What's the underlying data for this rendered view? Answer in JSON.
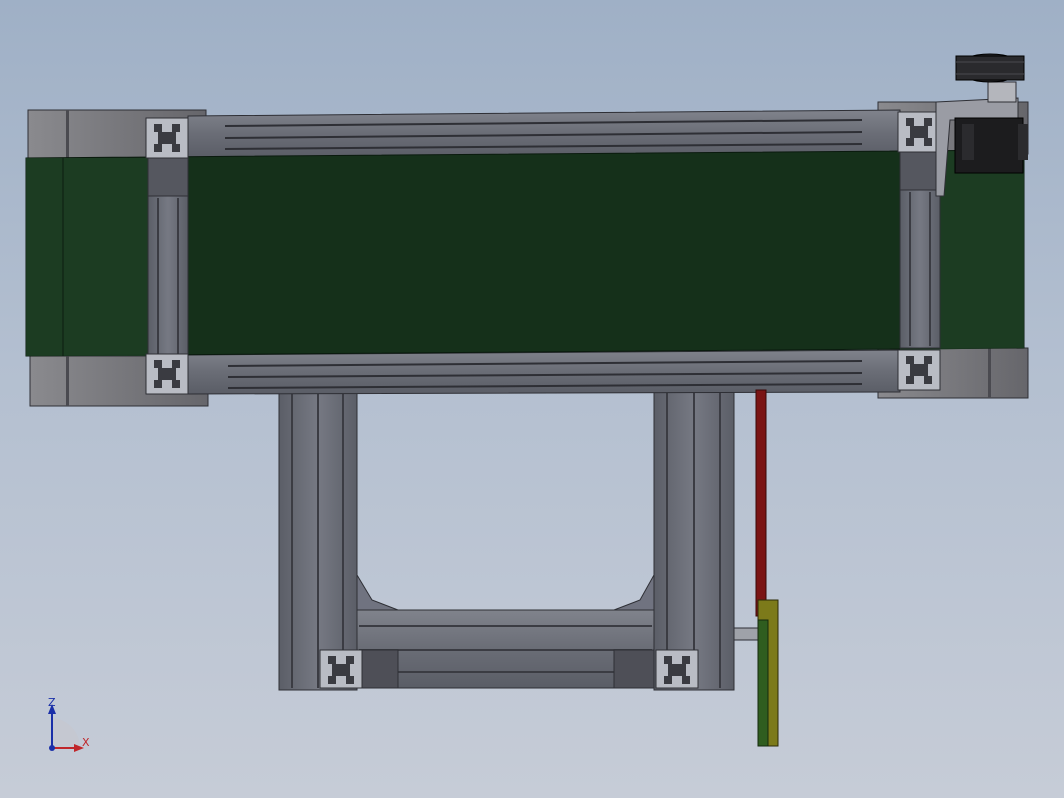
{
  "viewport": {
    "background_top": "#9fb0c6",
    "background_bottom": "#c6ccd7"
  },
  "model": {
    "parts": [
      "aluminum-frame",
      "conveyor-belt",
      "drive-motor",
      "tension-rollers",
      "support-legs",
      "sensor-bracket"
    ],
    "colors": {
      "belt": "#15301a",
      "belt_edge": "#21492a",
      "aluminum": "#6c6f78",
      "aluminum_dark": "#3f4048",
      "roller": "#7b7b80",
      "motor": "#1c1c1e",
      "sensor_red": "#7a1414",
      "sensor_yellow": "#7c7a1a",
      "sensor_green": "#2f5d1f"
    }
  },
  "triad": {
    "z_label": "Z",
    "x_label": "X",
    "z_color": "#1a2fa8",
    "x_color": "#c0262a"
  }
}
